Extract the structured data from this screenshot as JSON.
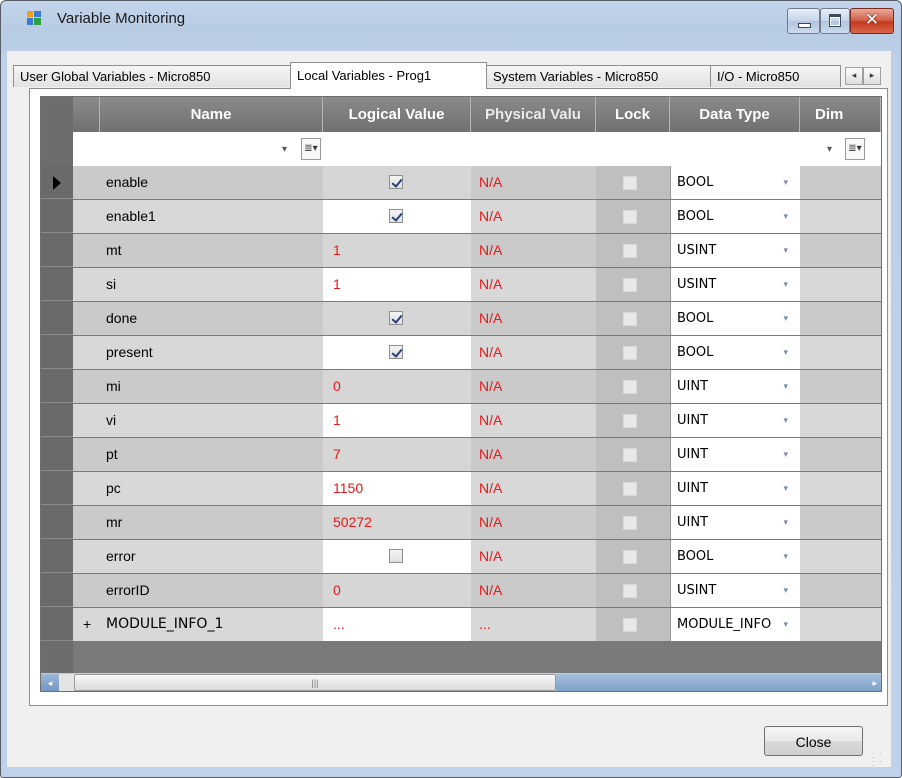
{
  "window": {
    "title": "Variable Monitoring",
    "minimize_icon": "minimize-icon",
    "maximize_icon": "maximize-icon",
    "close_icon": "close-icon",
    "close_glyph": "✕"
  },
  "tabs": [
    {
      "label": "User Global Variables - Micro850",
      "active": false
    },
    {
      "label": "Local Variables - Prog1",
      "active": true
    },
    {
      "label": "System Variables - Micro850",
      "active": false
    },
    {
      "label": "I/O - Micro850",
      "active": false
    }
  ],
  "tab_scroll": {
    "left": "◂",
    "right": "▸"
  },
  "grid": {
    "columns": [
      "Name",
      "Logical Value",
      "Physical Valu",
      "Lock",
      "Data Type",
      "Dim"
    ],
    "filter_icon": "filter-icon",
    "filter_glyph": "≣▾",
    "dropdown_glyph": "▾",
    "rows": [
      {
        "name": "enable",
        "logical": "",
        "logical_check": true,
        "physical": "N/A",
        "datatype": "BOOL",
        "selected": true
      },
      {
        "name": "enable1",
        "logical": "",
        "logical_check": true,
        "physical": "N/A",
        "datatype": "BOOL"
      },
      {
        "name": "mt",
        "logical": "1",
        "physical": "N/A",
        "datatype": "USINT"
      },
      {
        "name": "si",
        "logical": "1",
        "physical": "N/A",
        "datatype": "USINT"
      },
      {
        "name": "done",
        "logical": "",
        "logical_check": true,
        "physical": "N/A",
        "datatype": "BOOL"
      },
      {
        "name": "present",
        "logical": "",
        "logical_check": true,
        "physical": "N/A",
        "datatype": "BOOL"
      },
      {
        "name": "mi",
        "logical": "0",
        "physical": "N/A",
        "datatype": "UINT"
      },
      {
        "name": "vi",
        "logical": "1",
        "physical": "N/A",
        "datatype": "UINT"
      },
      {
        "name": "pt",
        "logical": "7",
        "physical": "N/A",
        "datatype": "UINT"
      },
      {
        "name": "pc",
        "logical": "1150",
        "physical": "N/A",
        "datatype": "UINT"
      },
      {
        "name": "mr",
        "logical": "50272",
        "physical": "N/A",
        "datatype": "UINT"
      },
      {
        "name": "error",
        "logical": "",
        "logical_check": false,
        "physical": "N/A",
        "datatype": "BOOL"
      },
      {
        "name": "errorID",
        "logical": "0",
        "physical": "N/A",
        "datatype": "USINT"
      },
      {
        "name": "MODULE_INFO_1",
        "logical": "...",
        "physical": "...",
        "datatype": "MODULE_INFO",
        "expandable": true,
        "expand_glyph": "+"
      }
    ]
  },
  "scrollbar": {
    "left_arrow": "◂",
    "right_arrow": "▸",
    "grip": "|||"
  },
  "buttons": {
    "close": "Close"
  },
  "colors": {
    "value_red": "#e21a1a",
    "header_gray": "#7a7a7a",
    "title_bar": "#bfd2ea",
    "close_red": "#c43a1f"
  }
}
